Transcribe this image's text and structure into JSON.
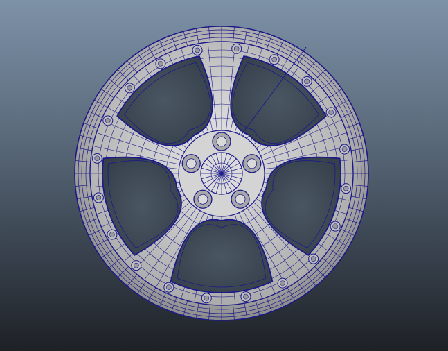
{
  "viewport": {
    "background_top": "#7d91a7",
    "background_bottom": "#1e2126",
    "wireframe_color": "#1c1a8a",
    "surface_color": "#c7c7c7"
  },
  "model": {
    "object": "wheel-rim",
    "spoke_count": 5,
    "lug_nut_count": 5,
    "rim_bolt_count": 20,
    "display_mode": "wireframe-on-shaded"
  }
}
